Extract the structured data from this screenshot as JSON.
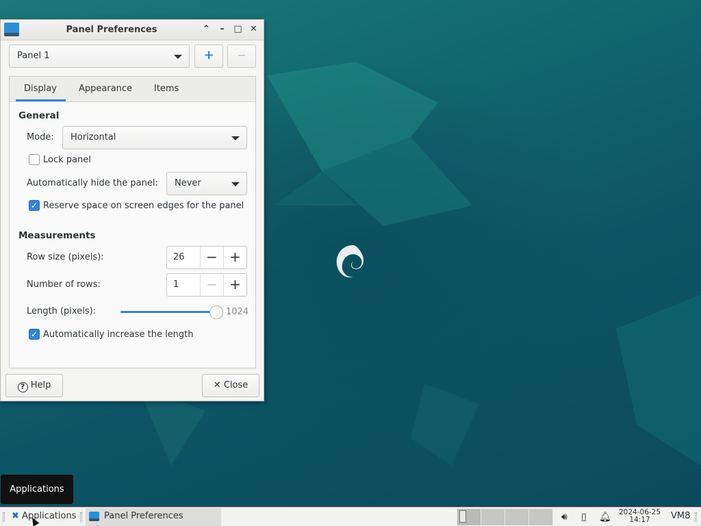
{
  "window": {
    "title": "Panel Preferences",
    "panel_selector": "Panel 1",
    "add_glyph": "+",
    "remove_glyph": "−"
  },
  "tabs": [
    {
      "label": "Display",
      "active": true
    },
    {
      "label": "Appearance",
      "active": false
    },
    {
      "label": "Items",
      "active": false
    }
  ],
  "general": {
    "heading": "General",
    "mode_label": "Mode:",
    "mode_value": "Horizontal",
    "lock_label": "Lock panel",
    "lock_checked": false,
    "autohide_label": "Automatically hide the panel:",
    "autohide_value": "Never",
    "reserve_label": "Reserve space on screen edges for the panel",
    "reserve_checked": true
  },
  "measurements": {
    "heading": "Measurements",
    "row_size_label": "Row size (pixels):",
    "row_size_value": "26",
    "rows_label": "Number of rows:",
    "rows_value": "1",
    "length_label": "Length (pixels):",
    "length_value": "1024",
    "length_fraction": 1.0,
    "auto_increase_label": "Automatically increase the length",
    "auto_increase_checked": true
  },
  "buttons": {
    "help": "Help",
    "close": "Close"
  },
  "tooltip": "Applications",
  "taskbar": {
    "applications": "Applications",
    "task": "Panel Preferences",
    "clock_date": "2024-06-25",
    "clock_time": "14:17",
    "host": "VM8"
  },
  "colors": {
    "accent": "#3584d6",
    "desktop": "#0f5a66"
  }
}
